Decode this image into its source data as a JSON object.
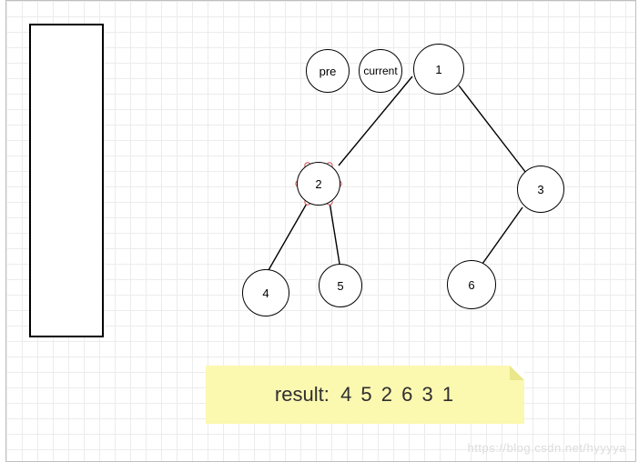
{
  "nodes": {
    "pre": "pre",
    "current": "current",
    "n1": "1",
    "n2": "2",
    "n3": "3",
    "n4": "4",
    "n5": "5",
    "n6": "6"
  },
  "result": {
    "label": "result:",
    "values": "4 5 2 6 3 1"
  },
  "watermark": "https://blog.csdn.net/hyyyya",
  "chart_data": {
    "type": "tree-diagram",
    "title": "",
    "annotations": [
      "pre",
      "current"
    ],
    "tree": {
      "value": 1,
      "left": {
        "value": 2,
        "left": {
          "value": 4
        },
        "right": {
          "value": 5
        }
      },
      "right": {
        "value": 3,
        "left": {
          "value": 6
        }
      }
    },
    "traversal_label": "result",
    "traversal_order": [
      4,
      5,
      2,
      6,
      3,
      1
    ],
    "selected_node": 2,
    "stack_box_present": true
  }
}
